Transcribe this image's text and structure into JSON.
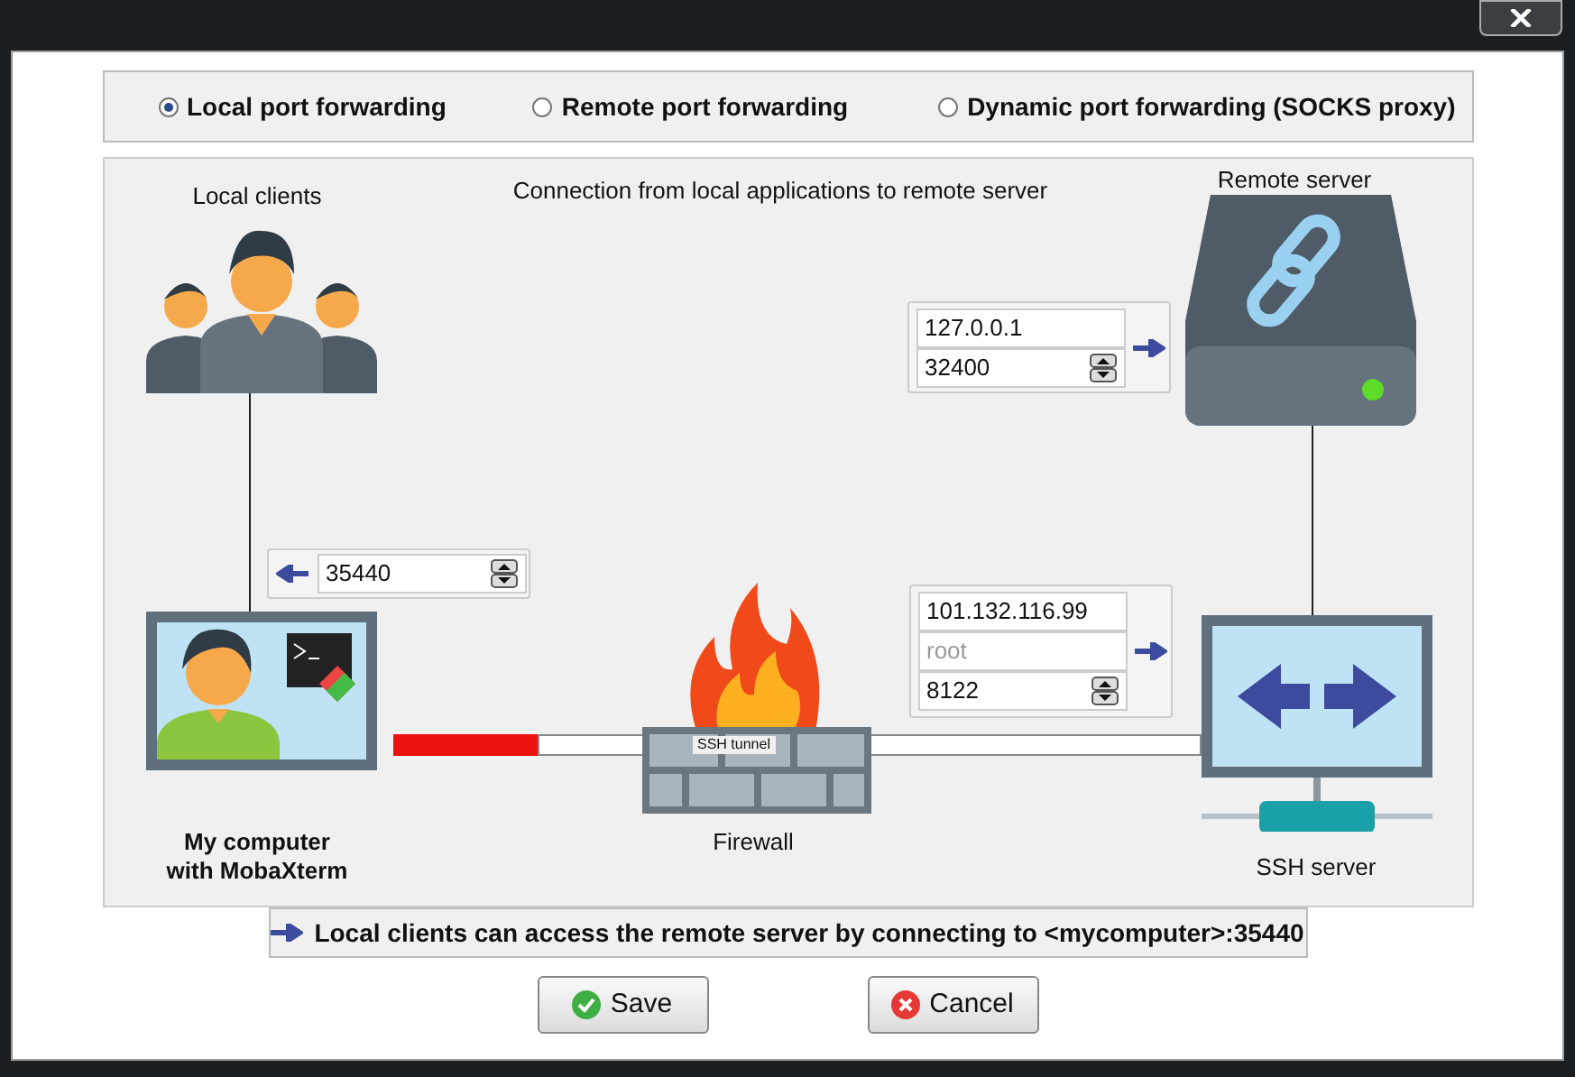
{
  "forwarding_types": [
    {
      "label": "Local port forwarding",
      "selected": true
    },
    {
      "label": "Remote port forwarding",
      "selected": false
    },
    {
      "label": "Dynamic port forwarding (SOCKS proxy)",
      "selected": false
    }
  ],
  "diagram": {
    "caption": "Connection from local applications to remote server",
    "local_clients_label": "Local clients",
    "remote_server_label": "Remote server",
    "my_computer_label": "My computer\nwith MobaXterm",
    "firewall_label": "Firewall",
    "ssh_server_label": "SSH server",
    "tunnel_label": "SSH tunnel",
    "local_port": "35440",
    "remote_target": {
      "host": "127.0.0.1",
      "port": "32400"
    },
    "ssh": {
      "host": "101.132.116.99",
      "user_placeholder": "root",
      "port": "8122"
    }
  },
  "info": "Local clients can access the remote server by connecting to <mycomputer>:35440",
  "buttons": [
    {
      "label": "Save",
      "kind": "save"
    },
    {
      "label": "Cancel",
      "kind": "cancel"
    }
  ]
}
